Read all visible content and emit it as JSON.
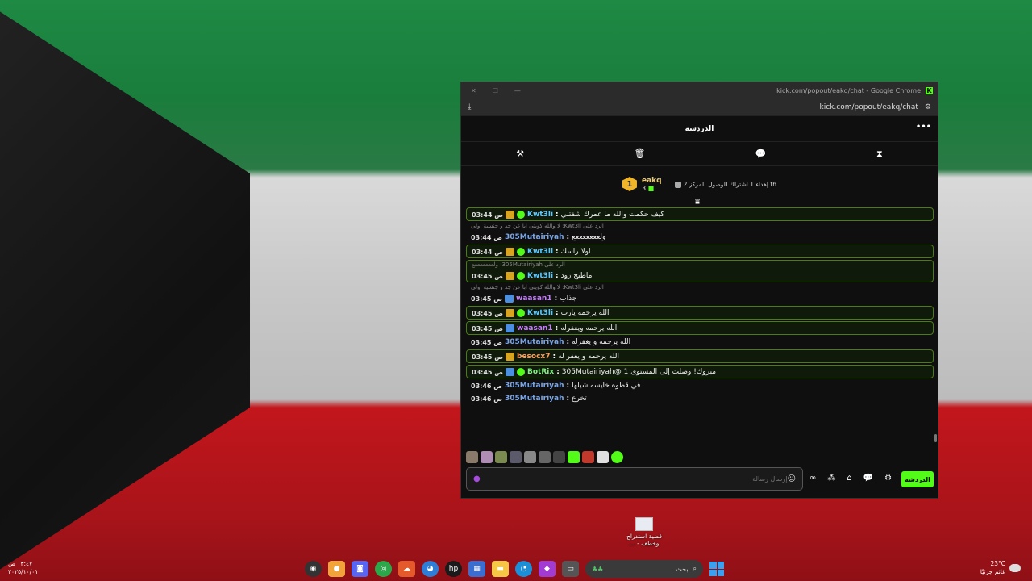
{
  "window": {
    "title": "kick.com/popout/eakq/chat - Google Chrome",
    "url": "kick.com/popout/eakq/chat",
    "chat_title": "الدردشة"
  },
  "gifter": {
    "name": "eakq",
    "count": "3",
    "rank": "1",
    "goal_text": "إهداء 1 اشتراك للوصول للمركز 2 th"
  },
  "messages": [
    {
      "time": "03:44 ص",
      "user": "Kwt3li",
      "text": "كيف حكمت والله ما عمرك شفتني",
      "color": "#5ec8ff",
      "hl": true,
      "badges": [
        "crown",
        "verified"
      ]
    },
    {
      "reply": "الرد على Kwt3li: لا والله كويتي ابا عن جد و جنسية اولى",
      "time": "03:44 ص",
      "user": "305Mutairiyah",
      "text": "ولعععععععع",
      "color": "#7aa6e8",
      "hl": false,
      "badges": []
    },
    {
      "time": "03:44 ص",
      "user": "Kwt3li",
      "text": "اولا راسك",
      "color": "#5ec8ff",
      "hl": true,
      "badges": [
        "crown",
        "verified"
      ]
    },
    {
      "reply": "الرد على 305Mutairiyah: ولعععععععع",
      "time": "03:45 ص",
      "user": "Kwt3li",
      "text": "ماطيح زود",
      "color": "#5ec8ff",
      "hl": true,
      "badges": [
        "crown",
        "verified"
      ]
    },
    {
      "reply": "الرد على Kwt3li: لا والله كويتي ابا عن جد و جنسية اولى",
      "time": "03:45 ص",
      "user": "waasan1",
      "text": "جذاب",
      "color": "#c77dff",
      "hl": false,
      "badges": [
        "arrow"
      ]
    },
    {
      "time": "03:45 ص",
      "user": "Kwt3li",
      "text": "الله يرحمه يارب",
      "color": "#5ec8ff",
      "hl": true,
      "badges": [
        "crown",
        "verified"
      ]
    },
    {
      "time": "03:45 ص",
      "user": "waasan1",
      "text": "الله يرحمه ويغفرله",
      "color": "#c77dff",
      "hl": true,
      "badges": [
        "arrow"
      ]
    },
    {
      "time": "03:45 ص",
      "user": "305Mutairiyah",
      "text": "الله يرحمه و يغفرله",
      "color": "#7aa6e8",
      "hl": false,
      "badges": []
    },
    {
      "time": "03:45 ص",
      "user": "besocx7",
      "text": "الله يرحمه و يغفر له",
      "color": "#ff9f5a",
      "hl": true,
      "badges": [
        "crown"
      ]
    },
    {
      "time": "03:45 ص",
      "user": "BotRix",
      "text": "مبروك! وصلت إلى المستوى 1 @305Mutairiyah",
      "color": "#7ff07f",
      "hl": true,
      "badges": [
        "arrow",
        "verified"
      ]
    },
    {
      "time": "03:46 ص",
      "user": "305Mutairiyah",
      "text": "في قطوه خايسه شيلها",
      "color": "#7aa6e8",
      "hl": false,
      "badges": []
    },
    {
      "time": "03:46 ص",
      "user": "305Mutairiyah",
      "text": "تخرع",
      "color": "#7aa6e8",
      "hl": false,
      "badges": []
    }
  ],
  "input": {
    "placeholder": "إرسال رسالة"
  },
  "chat_button": "الدردشة",
  "desktop_icon": {
    "label_line1": "قضية استدراج",
    "label_line2": "... - وخطف"
  },
  "taskbar": {
    "time": "٠٣:٤٧ ص",
    "date": "٢٠٢٥/١٠/٠١",
    "search": "بحث",
    "weather_temp": "23°C",
    "weather_desc": "غائم جزئيًا"
  }
}
